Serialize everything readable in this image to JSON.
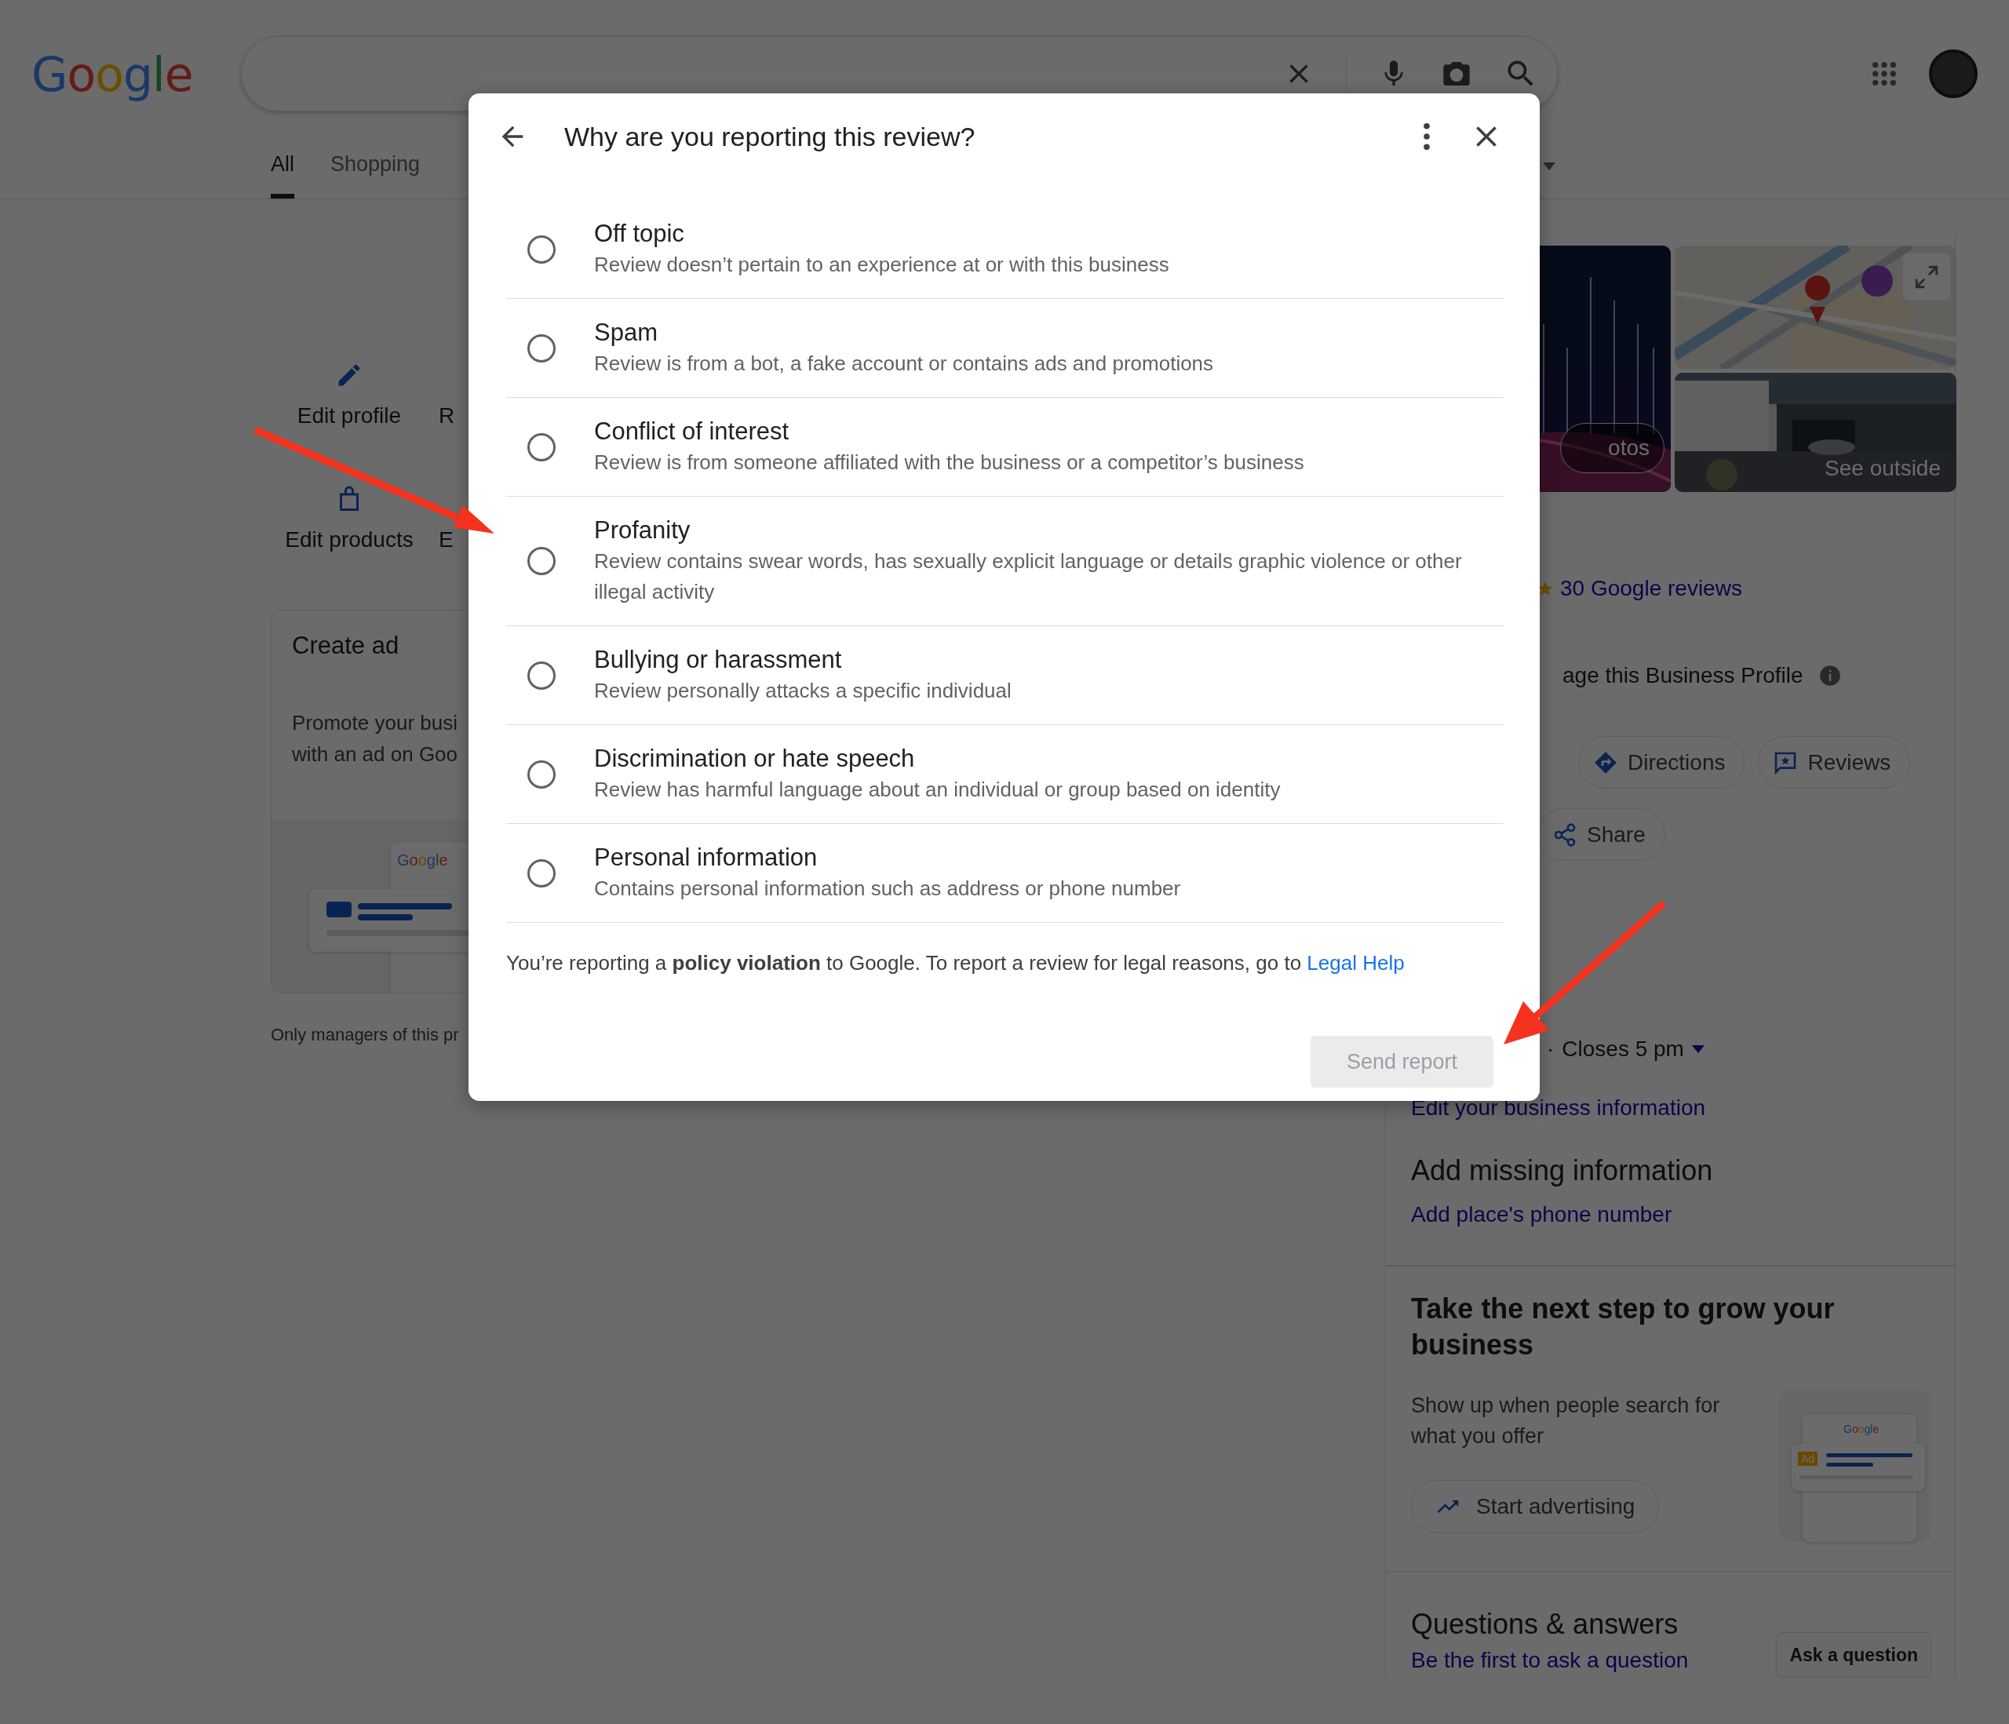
{
  "header": {
    "logo": "Google"
  },
  "tabs": [
    {
      "label": "All",
      "selected": true
    },
    {
      "label": "Shopping",
      "selected": false
    }
  ],
  "profile_actions": [
    [
      {
        "label": "Edit profile"
      },
      {
        "label": "R"
      }
    ],
    [
      {
        "label": "Edit products"
      },
      {
        "label": "E"
      }
    ]
  ],
  "create_ad": {
    "title": "Create ad",
    "lines": [
      "Promote your busi",
      "with an ad on Goo"
    ],
    "preview_logo": "Google"
  },
  "managers_note": "Only managers of this pr",
  "business_panel": {
    "photos_button": "otos",
    "see_outside": "See outside",
    "reviews_link": "30 Google reviews",
    "manage_text": "age this Business Profile",
    "chips": [
      {
        "label": "Directions"
      },
      {
        "label": "Reviews"
      }
    ],
    "share_chip": "Share",
    "hours": {
      "separator": "·",
      "text": "Closes 5 pm"
    },
    "edit_info_link": "Edit your business information",
    "missing": {
      "title": "Add missing information",
      "link": "Add place's phone number"
    },
    "grow": {
      "title": "Take the next step to grow your business",
      "text": "Show up when people search for what you offer",
      "button": "Start advertising",
      "preview_logo": "Google",
      "preview_badge": "Ad"
    },
    "qa": {
      "title": "Questions & answers",
      "link": "Be the first to ask a question",
      "button": "Ask a question"
    }
  },
  "dialog": {
    "title": "Why are you reporting this review?",
    "options": [
      {
        "title": "Off topic",
        "description": "Review doesn’t pertain to an experience at or with this business",
        "selected": false
      },
      {
        "title": "Spam",
        "description": "Review is from a bot, a fake account or contains ads and promotions",
        "selected": false
      },
      {
        "title": "Conflict of interest",
        "description": "Review is from someone affiliated with the business or a competitor’s business",
        "selected": false
      },
      {
        "title": "Profanity",
        "description": "Review contains swear words, has sexually explicit language or details graphic violence or other illegal activity",
        "selected": false
      },
      {
        "title": "Bullying or harassment",
        "description": "Review personally attacks a specific individual",
        "selected": false
      },
      {
        "title": "Discrimination or hate speech",
        "description": "Review has harmful language about an individual or group based on identity",
        "selected": false
      },
      {
        "title": "Personal information",
        "description": "Contains personal information such as address or phone number",
        "selected": false
      }
    ],
    "footer": "You’re reporting a **policy violation** to Google. To report a review for legal reasons, go to",
    "footer_link": "Legal Help",
    "submit": {
      "label": "Send report",
      "disabled": true
    }
  }
}
